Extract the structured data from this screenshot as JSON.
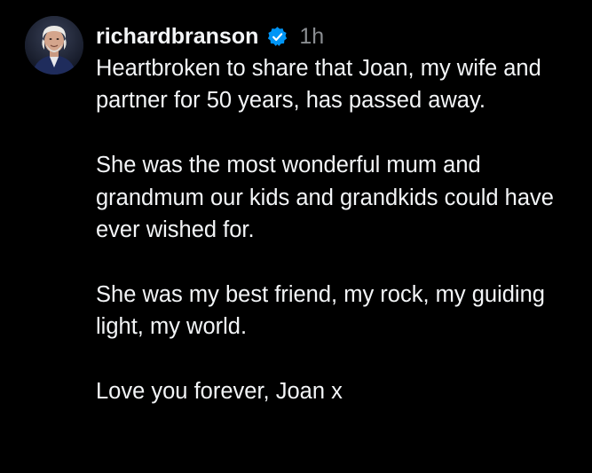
{
  "post": {
    "username": "richardbranson",
    "verified": true,
    "timestamp": "1h",
    "paragraphs": [
      "Heartbroken to share that Joan, my wife and partner for 50 years, has passed away.",
      "She was the most wonderful mum and grandmum our kids and grandkids could have ever wished for.",
      "She was my best friend, my rock, my guiding light, my world.",
      "Love you forever, Joan x"
    ]
  },
  "icons": {
    "avatar": "avatar-photo",
    "verified": "verified-badge-icon"
  },
  "colors": {
    "background": "#000000",
    "text": "#f3f5f7",
    "secondary_text": "#8a8d91",
    "verified_badge": "#0095f6"
  }
}
